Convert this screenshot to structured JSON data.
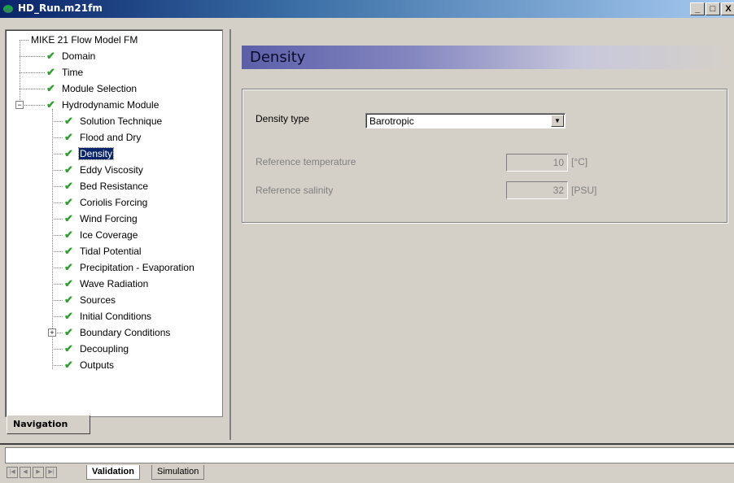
{
  "window": {
    "title": "HD_Run.m21fm",
    "buttons": {
      "minimize": "_",
      "restore": "□",
      "close": "X"
    }
  },
  "navigation": {
    "tab_label": "Navigation",
    "tree": [
      {
        "label": "MIKE 21 Flow Model FM",
        "level": 0,
        "checked": false
      },
      {
        "label": "Domain",
        "level": 1,
        "checked": true
      },
      {
        "label": "Time",
        "level": 1,
        "checked": true
      },
      {
        "label": "Module Selection",
        "level": 1,
        "checked": true
      },
      {
        "label": "Hydrodynamic Module",
        "level": 1,
        "checked": true,
        "expander": "−"
      },
      {
        "label": "Solution Technique",
        "level": 2,
        "checked": true
      },
      {
        "label": "Flood and Dry",
        "level": 2,
        "checked": true
      },
      {
        "label": "Density",
        "level": 2,
        "checked": true,
        "selected": true
      },
      {
        "label": "Eddy Viscosity",
        "level": 2,
        "checked": true
      },
      {
        "label": "Bed Resistance",
        "level": 2,
        "checked": true
      },
      {
        "label": "Coriolis Forcing",
        "level": 2,
        "checked": true
      },
      {
        "label": "Wind Forcing",
        "level": 2,
        "checked": true
      },
      {
        "label": "Ice Coverage",
        "level": 2,
        "checked": true
      },
      {
        "label": "Tidal Potential",
        "level": 2,
        "checked": true
      },
      {
        "label": "Precipitation - Evaporation",
        "level": 2,
        "checked": true
      },
      {
        "label": "Wave Radiation",
        "level": 2,
        "checked": true
      },
      {
        "label": "Sources",
        "level": 2,
        "checked": true
      },
      {
        "label": "Initial Conditions",
        "level": 2,
        "checked": true
      },
      {
        "label": "Boundary Conditions",
        "level": 2,
        "checked": true,
        "expander": "+"
      },
      {
        "label": "Decoupling",
        "level": 2,
        "checked": true
      },
      {
        "label": "Outputs",
        "level": 2,
        "checked": true
      }
    ]
  },
  "density_page": {
    "title": "Density",
    "density_type_label": "Density type",
    "density_type_value": "Barotropic",
    "reference_temperature": {
      "label": "Reference temperature",
      "value": "10",
      "unit": "[°C]"
    },
    "reference_salinity": {
      "label": "Reference salinity",
      "value": "32",
      "unit": "[PSU]"
    }
  },
  "bottom_tabs": {
    "tabs": [
      "Validation",
      "Simulation"
    ],
    "active": "Validation"
  },
  "colors": {
    "title_bar": "#0a246a",
    "selection": "#0a246a",
    "check": "#2ea02e",
    "header_band": "#5b5fa8"
  }
}
